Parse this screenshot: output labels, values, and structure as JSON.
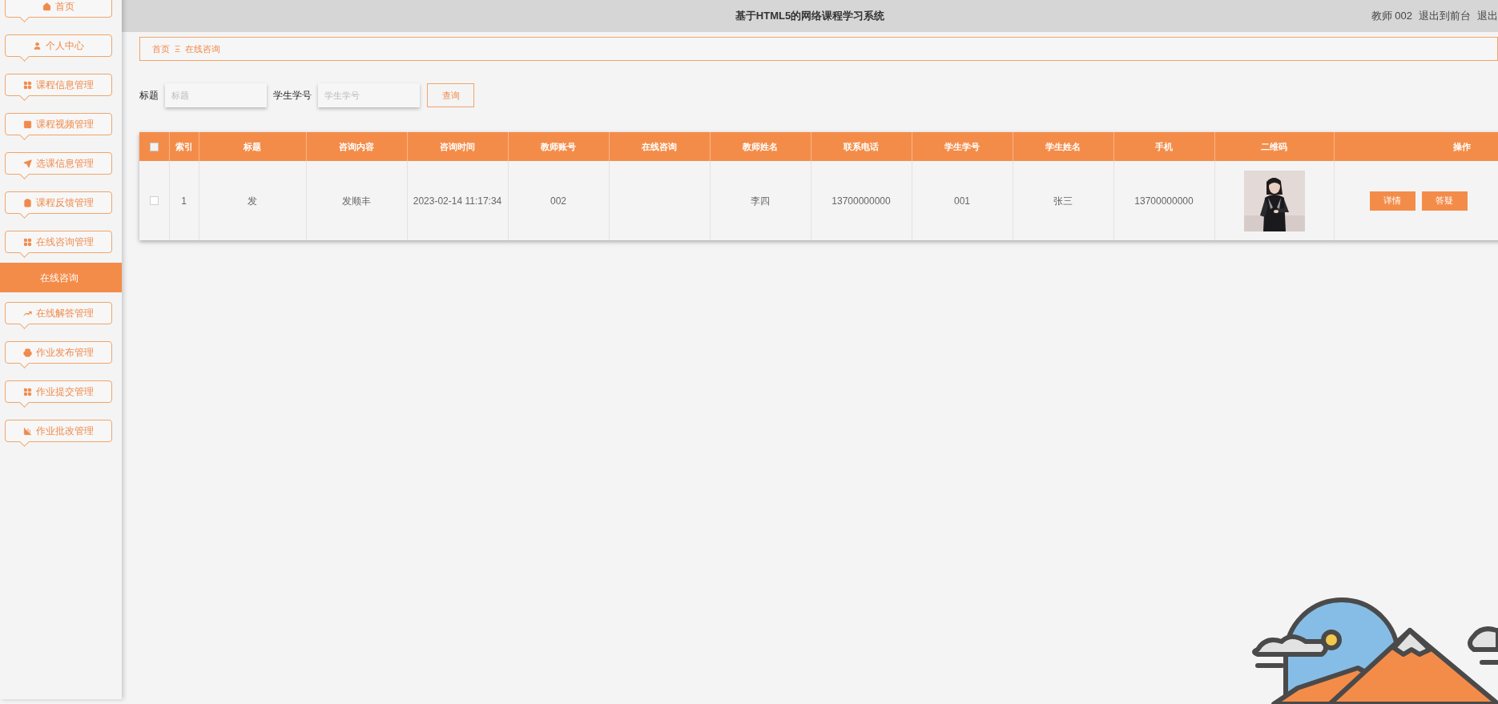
{
  "header": {
    "title": "基于HTML5的网络课程学习系统",
    "user_links": [
      "教师 002",
      "退出到前台",
      "退出"
    ]
  },
  "sidebar": {
    "items": [
      {
        "label": "首页",
        "selected": false
      },
      {
        "label": "个人中心",
        "selected": false
      },
      {
        "label": "课程信息管理",
        "selected": false
      },
      {
        "label": "课程视频管理",
        "selected": false
      },
      {
        "label": "选课信息管理",
        "selected": false
      },
      {
        "label": "课程反馈管理",
        "selected": false
      },
      {
        "label": "在线咨询管理",
        "selected": false,
        "children": [
          {
            "label": "在线咨询",
            "selected": true
          }
        ]
      },
      {
        "label": "在线解答管理",
        "selected": false
      },
      {
        "label": "作业发布管理",
        "selected": false
      },
      {
        "label": "作业提交管理",
        "selected": false
      },
      {
        "label": "作业批改管理",
        "selected": false
      }
    ]
  },
  "breadcrumb": {
    "items": [
      "首页",
      "在线咨询"
    ],
    "separator": "Ξ"
  },
  "search": {
    "fields": [
      {
        "label": "标题",
        "placeholder": "标题"
      },
      {
        "label": "学生学号",
        "placeholder": "学生学号"
      }
    ],
    "button": "查询"
  },
  "table": {
    "select_all": {
      "checked": false
    },
    "columns": [
      "索引",
      "标题",
      "咨询内容",
      "咨询时间",
      "教师账号",
      "在线咨询",
      "教师姓名",
      "联系电话",
      "学生学号",
      "学生姓名",
      "手机",
      "二维码",
      "操作"
    ],
    "rows": [
      {
        "checked": false,
        "cells": [
          "1",
          "发",
          "发顺丰",
          "2023-02-14 11:17:34",
          "002",
          "",
          "李四",
          "13700000000",
          "001",
          "张三",
          "13700000000"
        ],
        "image": {
          "kind": "picture"
        },
        "actions": [
          "详情",
          "答疑"
        ]
      }
    ]
  }
}
